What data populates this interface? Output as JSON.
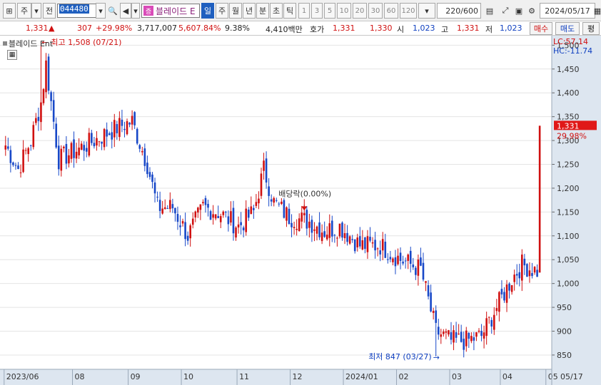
{
  "toolbar": {
    "stock_type": "주",
    "market_toggle": "전",
    "code": "044480",
    "stock_name": "블레이드 E",
    "name_badge": "증",
    "periods": [
      "일",
      "주",
      "월",
      "년",
      "분",
      "초",
      "틱"
    ],
    "selected_period": "일",
    "intervals": [
      "1",
      "3",
      "5",
      "10",
      "20",
      "30",
      "60",
      "120"
    ],
    "count": "220",
    "count_total": "/600",
    "date": "2024/05/17"
  },
  "quote": {
    "price": "1,331",
    "change": "307",
    "change_pct": "+29.98%",
    "volume": "3,717,007",
    "volume_ratio": "5,607.84%",
    "turnover": "9.38%",
    "amount": "4,410백만",
    "bid_label": "호가",
    "ask": "1,331",
    "bid": "1,330",
    "open_label": "시",
    "open": "1,023",
    "high_label": "고",
    "high": "1,331",
    "low_label": "저",
    "low": "1,023",
    "buy_button": "매수",
    "sell_button": "매도",
    "eval_button": "평"
  },
  "chart": {
    "title": "블레이드 Ent",
    "lc_label": "LC:57.14",
    "hc_label": "HC:-11.74",
    "current_price_label": "1,331",
    "current_pct_label": "29.98%",
    "max_annotation": "최고 1,508 (07/21)",
    "min_annotation": "최저 847 (03/27)",
    "dividend_annotation": "배당락(0.00%)",
    "colors": {
      "up": "#d01010",
      "down": "#1848c8",
      "grid": "#e4e4e4",
      "axis_bg": "#dde6f0"
    }
  },
  "chart_data": {
    "type": "candlestick",
    "ylim": [
      820,
      1520
    ],
    "y_ticks": [
      850,
      900,
      950,
      1000,
      1050,
      1100,
      1150,
      1200,
      1250,
      1300,
      1350,
      1400,
      1450,
      1500
    ],
    "y_tick_labels": [
      "850",
      "900",
      "950",
      "1,000",
      "1,050",
      "1,100",
      "1,150",
      "1,200",
      "1,250",
      "1,300",
      "1,350",
      "1,400",
      "1,450",
      "1,500"
    ],
    "x_labels": [
      "2023/06",
      "08",
      "09",
      "10",
      "11",
      "12",
      "2024/01",
      "02",
      "03",
      "04",
      "05",
      "05/17"
    ],
    "anchors": [
      {
        "i": 0,
        "c": 1290
      },
      {
        "i": 5,
        "c": 1240
      },
      {
        "i": 10,
        "c": 1300
      },
      {
        "i": 14,
        "c": 1380
      },
      {
        "i": 16,
        "c": 1460
      },
      {
        "i": 18,
        "c": 1380
      },
      {
        "i": 21,
        "c": 1260
      },
      {
        "i": 28,
        "c": 1280
      },
      {
        "i": 35,
        "c": 1300
      },
      {
        "i": 45,
        "c": 1330
      },
      {
        "i": 50,
        "c": 1340
      },
      {
        "i": 56,
        "c": 1250
      },
      {
        "i": 60,
        "c": 1160
      },
      {
        "i": 66,
        "c": 1160
      },
      {
        "i": 72,
        "c": 1100
      },
      {
        "i": 78,
        "c": 1160
      },
      {
        "i": 84,
        "c": 1150
      },
      {
        "i": 92,
        "c": 1120
      },
      {
        "i": 98,
        "c": 1150
      },
      {
        "i": 102,
        "c": 1240
      },
      {
        "i": 106,
        "c": 1170
      },
      {
        "i": 112,
        "c": 1140
      },
      {
        "i": 120,
        "c": 1130
      },
      {
        "i": 126,
        "c": 1110
      },
      {
        "i": 132,
        "c": 1120
      },
      {
        "i": 140,
        "c": 1080
      },
      {
        "i": 148,
        "c": 1080
      },
      {
        "i": 156,
        "c": 1050
      },
      {
        "i": 164,
        "c": 1030
      },
      {
        "i": 170,
        "c": 900
      },
      {
        "i": 176,
        "c": 880
      },
      {
        "i": 182,
        "c": 880
      },
      {
        "i": 188,
        "c": 890
      },
      {
        "i": 194,
        "c": 950
      },
      {
        "i": 200,
        "c": 1010
      },
      {
        "i": 204,
        "c": 1040
      },
      {
        "i": 208,
        "c": 1030
      },
      {
        "i": 211,
        "c": 1024
      }
    ],
    "last_candle": {
      "open": 1023,
      "high": 1331,
      "low": 1023,
      "close": 1331
    },
    "max_point": {
      "value": 1508,
      "date": "07/21"
    },
    "min_point": {
      "value": 847,
      "date": "03/27"
    }
  }
}
